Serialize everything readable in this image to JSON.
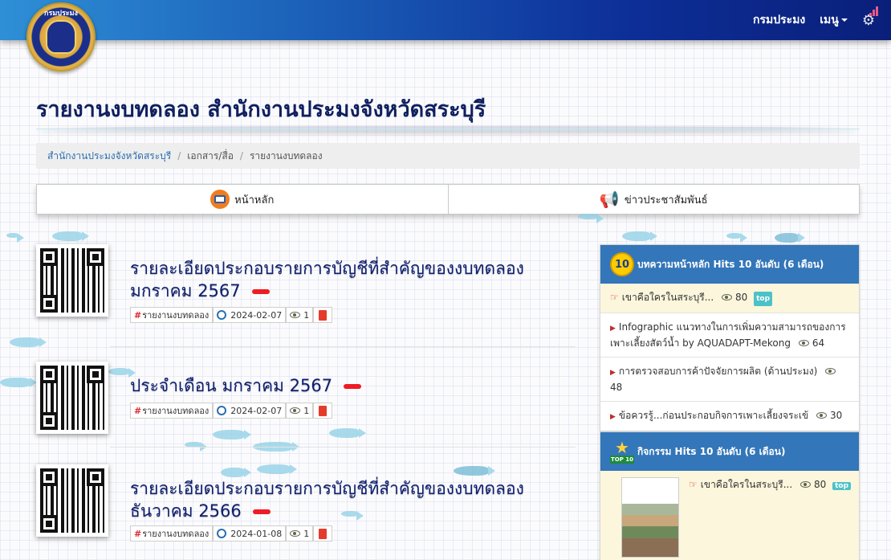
{
  "navbar": {
    "logo_text": "กรมประมง",
    "links": [
      "กรมประมง",
      "เมนู"
    ],
    "gear": "gear-icon",
    "bars": "signal-bars-icon"
  },
  "page": {
    "title": "รายงานงบทดลอง สำนักงานประมงจังหวัดสระบุรี"
  },
  "breadcrumb": {
    "items": [
      "สำนักงานประมงจังหวัดสระบุรี",
      "เอกสาร/สื่อ",
      "รายงานงบทดลอง"
    ],
    "separator": "/"
  },
  "tabs": [
    {
      "label": "หน้าหลัก",
      "icon": "home-icon"
    },
    {
      "label": "ข่าวประชาสัมพันธ์",
      "icon": "megaphone-icon"
    }
  ],
  "articles": [
    {
      "title_line1": "รายละเอียดประกอบรายการบัญชีที่สำคัญของงบทดลอง",
      "title_line2": "มกราคม 2567",
      "category": "รายงานงบทดลอง",
      "date": "2024-02-07",
      "views": "1"
    },
    {
      "title_line1": "ประจำเดือน มกราคม 2567",
      "title_line2": "",
      "category": "รายงานงบทดลอง",
      "date": "2024-02-07",
      "views": "1"
    },
    {
      "title_line1": "รายละเอียดประกอบรายการบัญชีที่สำคัญของงบทดลอง",
      "title_line2": "ธันวาคม 2566",
      "category": "รายงานงบทดลอง",
      "date": "2024-01-08",
      "views": "1"
    }
  ],
  "sidebar": {
    "panel1": {
      "badge": "10",
      "heading": "บทความหน้าหลัก Hits 10 อันดับ (6 เดือน)",
      "items": [
        {
          "text": "เขาคือใครในสระบุรี...",
          "views": "80",
          "tag": "top"
        },
        {
          "text": "Infographic แนวทางในการเพิ่มความสามารถของการเพาะเลี้ยงสัตว์น้ำ by AQUADAPT-Mekong",
          "views": "64"
        },
        {
          "text": "การตรวจสอบการค้าปัจจัยการผลิต (ด้านประมง)",
          "views": "48"
        },
        {
          "text": "ข้อควรรู้...ก่อนประกอบกิจการเพาะเลี้ยงจระเข้",
          "views": "30"
        }
      ]
    },
    "panel2": {
      "badge_tag": "TOP 10",
      "heading": "กิจกรรม Hits 10 อันดับ (6 เดือน)",
      "item": {
        "text": "เขาคือใครในสระบุรี...",
        "views": "80",
        "tag": "top"
      }
    }
  },
  "colors": {
    "navbar_start": "#2e8fd6",
    "navbar_end": "#0a1f7a",
    "title": "#0f1f5f",
    "panel_head": "#3376b9",
    "new_badge": "#ee1c24"
  }
}
